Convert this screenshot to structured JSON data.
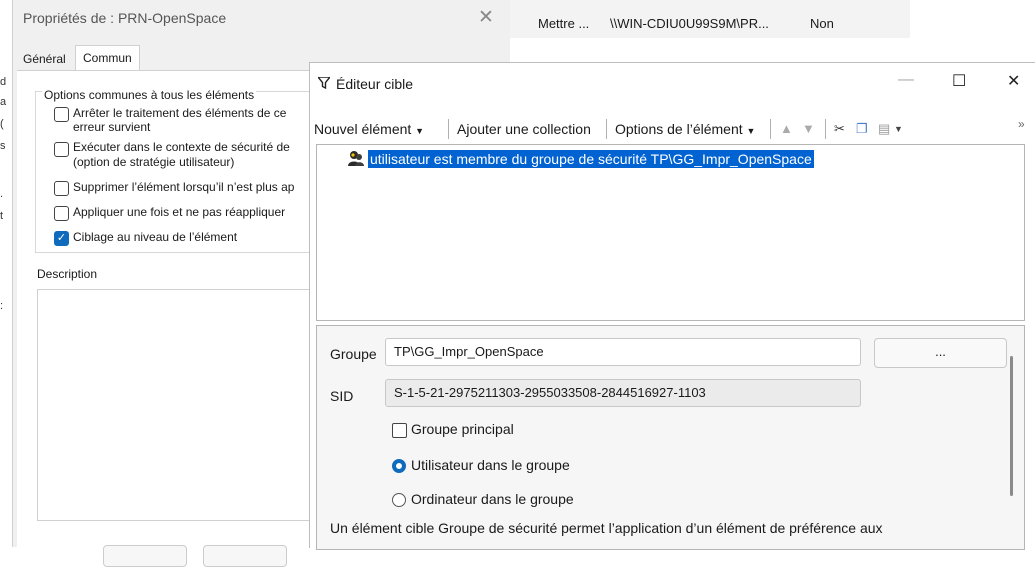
{
  "left_edge": [
    "d",
    "a",
    "(",
    "s",
    ".",
    "t",
    ":"
  ],
  "properties_dialog": {
    "title": "Propriétés de : PRN-OpenSpace",
    "tabs": [
      {
        "label": "Général",
        "active": false
      },
      {
        "label": "Commun",
        "active": true
      }
    ],
    "options_group": {
      "legend": "Options communes à tous les éléments",
      "options": [
        {
          "lines": [
            "Arrêter le traitement des éléments de ce",
            "erreur survient"
          ],
          "checked": false
        },
        {
          "lines": [
            "Exécuter dans le contexte de sécurité de",
            "(option de stratégie utilisateur)"
          ],
          "checked": false
        },
        {
          "lines": [
            "Supprimer l’élément lorsqu’il n’est plus ap"
          ],
          "checked": false
        },
        {
          "lines": [
            "Appliquer une fois et ne pas réappliquer"
          ],
          "checked": false
        },
        {
          "lines": [
            "Ciblage au niveau de l’élément"
          ],
          "checked": true
        }
      ]
    },
    "description_label": "Description"
  },
  "background_list": {
    "action": "Mettre ...",
    "path": "\\\\WIN-CDIU0U99S9M\\PR...",
    "value": "Non"
  },
  "editor": {
    "title": "Éditeur cible",
    "window_buttons": {
      "minimize": "—",
      "maximize": "☐",
      "close": "✕"
    },
    "toolbar": {
      "new_item": "Nouvel élément",
      "add_collection": "Ajouter une collection",
      "item_options": "Options de l’élément",
      "overflow": "»"
    },
    "tree_items": [
      "utilisateur est membre du groupe de sécurité TP\\GG_Impr_OpenSpace"
    ],
    "details": {
      "group_label": "Groupe",
      "group_value": "TP\\GG_Impr_OpenSpace",
      "browse_label": "...",
      "sid_label": "SID",
      "sid_value": "S-1-5-21-2975211303-2955033508-2844516927-1103",
      "primary_group_label": "Groupe principal",
      "primary_group_checked": false,
      "radio_user_label": "Utilisateur dans le groupe",
      "radio_computer_label": "Ordinateur dans le groupe",
      "selected_radio": "user",
      "help_text": "Un élément cible Groupe de sécurité permet l’application d’un élément de préférence aux"
    }
  },
  "colors": {
    "accent": "#0f6cbd",
    "selection": "#0063d1"
  }
}
